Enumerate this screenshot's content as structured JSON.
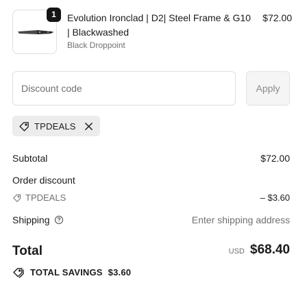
{
  "product": {
    "quantity": "1",
    "title": "Evolution Ironclad | D2| Steel Frame & G10 | Blackwashed",
    "variant": "Black Droppoint",
    "price": "$72.00",
    "image_icon": "knife-icon"
  },
  "discount": {
    "placeholder": "Discount code",
    "value": "",
    "apply_label": "Apply"
  },
  "applied_code": {
    "code": "TPDEALS",
    "tag_icon": "tag-icon",
    "remove_icon": "close-icon"
  },
  "summary": {
    "subtotal_label": "Subtotal",
    "subtotal_value": "$72.00",
    "order_discount_label": "Order discount",
    "discount_code": "TPDEALS",
    "discount_value": "– $3.60",
    "shipping_label": "Shipping",
    "shipping_value": "Enter shipping address",
    "shipping_help_icon": "question-circle-icon"
  },
  "total": {
    "label": "Total",
    "currency": "USD",
    "amount": "$68.40"
  },
  "savings": {
    "label": "TOTAL SAVINGS",
    "amount": "$3.60",
    "icon": "savings-tag-icon"
  },
  "colors": {
    "text": "#1a1a1a",
    "muted": "#707070",
    "border": "#dedede",
    "chip_bg": "#ececec",
    "badge_bg": "#141414"
  }
}
